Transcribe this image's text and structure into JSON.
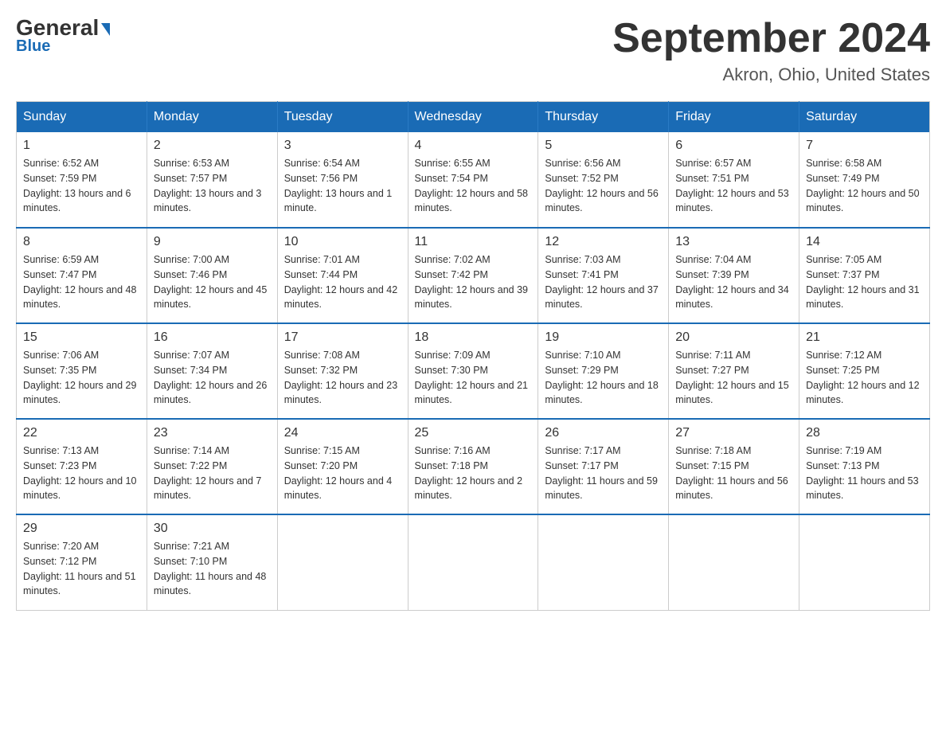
{
  "logo": {
    "text_general": "General",
    "triangle": "▶",
    "text_blue": "Blue"
  },
  "title": {
    "month_year": "September 2024",
    "location": "Akron, Ohio, United States"
  },
  "days_of_week": [
    "Sunday",
    "Monday",
    "Tuesday",
    "Wednesday",
    "Thursday",
    "Friday",
    "Saturday"
  ],
  "weeks": [
    [
      {
        "day": "1",
        "sunrise": "6:52 AM",
        "sunset": "7:59 PM",
        "daylight": "13 hours and 6 minutes."
      },
      {
        "day": "2",
        "sunrise": "6:53 AM",
        "sunset": "7:57 PM",
        "daylight": "13 hours and 3 minutes."
      },
      {
        "day": "3",
        "sunrise": "6:54 AM",
        "sunset": "7:56 PM",
        "daylight": "13 hours and 1 minute."
      },
      {
        "day": "4",
        "sunrise": "6:55 AM",
        "sunset": "7:54 PM",
        "daylight": "12 hours and 58 minutes."
      },
      {
        "day": "5",
        "sunrise": "6:56 AM",
        "sunset": "7:52 PM",
        "daylight": "12 hours and 56 minutes."
      },
      {
        "day": "6",
        "sunrise": "6:57 AM",
        "sunset": "7:51 PM",
        "daylight": "12 hours and 53 minutes."
      },
      {
        "day": "7",
        "sunrise": "6:58 AM",
        "sunset": "7:49 PM",
        "daylight": "12 hours and 50 minutes."
      }
    ],
    [
      {
        "day": "8",
        "sunrise": "6:59 AM",
        "sunset": "7:47 PM",
        "daylight": "12 hours and 48 minutes."
      },
      {
        "day": "9",
        "sunrise": "7:00 AM",
        "sunset": "7:46 PM",
        "daylight": "12 hours and 45 minutes."
      },
      {
        "day": "10",
        "sunrise": "7:01 AM",
        "sunset": "7:44 PM",
        "daylight": "12 hours and 42 minutes."
      },
      {
        "day": "11",
        "sunrise": "7:02 AM",
        "sunset": "7:42 PM",
        "daylight": "12 hours and 39 minutes."
      },
      {
        "day": "12",
        "sunrise": "7:03 AM",
        "sunset": "7:41 PM",
        "daylight": "12 hours and 37 minutes."
      },
      {
        "day": "13",
        "sunrise": "7:04 AM",
        "sunset": "7:39 PM",
        "daylight": "12 hours and 34 minutes."
      },
      {
        "day": "14",
        "sunrise": "7:05 AM",
        "sunset": "7:37 PM",
        "daylight": "12 hours and 31 minutes."
      }
    ],
    [
      {
        "day": "15",
        "sunrise": "7:06 AM",
        "sunset": "7:35 PM",
        "daylight": "12 hours and 29 minutes."
      },
      {
        "day": "16",
        "sunrise": "7:07 AM",
        "sunset": "7:34 PM",
        "daylight": "12 hours and 26 minutes."
      },
      {
        "day": "17",
        "sunrise": "7:08 AM",
        "sunset": "7:32 PM",
        "daylight": "12 hours and 23 minutes."
      },
      {
        "day": "18",
        "sunrise": "7:09 AM",
        "sunset": "7:30 PM",
        "daylight": "12 hours and 21 minutes."
      },
      {
        "day": "19",
        "sunrise": "7:10 AM",
        "sunset": "7:29 PM",
        "daylight": "12 hours and 18 minutes."
      },
      {
        "day": "20",
        "sunrise": "7:11 AM",
        "sunset": "7:27 PM",
        "daylight": "12 hours and 15 minutes."
      },
      {
        "day": "21",
        "sunrise": "7:12 AM",
        "sunset": "7:25 PM",
        "daylight": "12 hours and 12 minutes."
      }
    ],
    [
      {
        "day": "22",
        "sunrise": "7:13 AM",
        "sunset": "7:23 PM",
        "daylight": "12 hours and 10 minutes."
      },
      {
        "day": "23",
        "sunrise": "7:14 AM",
        "sunset": "7:22 PM",
        "daylight": "12 hours and 7 minutes."
      },
      {
        "day": "24",
        "sunrise": "7:15 AM",
        "sunset": "7:20 PM",
        "daylight": "12 hours and 4 minutes."
      },
      {
        "day": "25",
        "sunrise": "7:16 AM",
        "sunset": "7:18 PM",
        "daylight": "12 hours and 2 minutes."
      },
      {
        "day": "26",
        "sunrise": "7:17 AM",
        "sunset": "7:17 PM",
        "daylight": "11 hours and 59 minutes."
      },
      {
        "day": "27",
        "sunrise": "7:18 AM",
        "sunset": "7:15 PM",
        "daylight": "11 hours and 56 minutes."
      },
      {
        "day": "28",
        "sunrise": "7:19 AM",
        "sunset": "7:13 PM",
        "daylight": "11 hours and 53 minutes."
      }
    ],
    [
      {
        "day": "29",
        "sunrise": "7:20 AM",
        "sunset": "7:12 PM",
        "daylight": "11 hours and 51 minutes."
      },
      {
        "day": "30",
        "sunrise": "7:21 AM",
        "sunset": "7:10 PM",
        "daylight": "11 hours and 48 minutes."
      },
      null,
      null,
      null,
      null,
      null
    ]
  ],
  "labels": {
    "sunrise": "Sunrise:",
    "sunset": "Sunset:",
    "daylight": "Daylight:"
  }
}
